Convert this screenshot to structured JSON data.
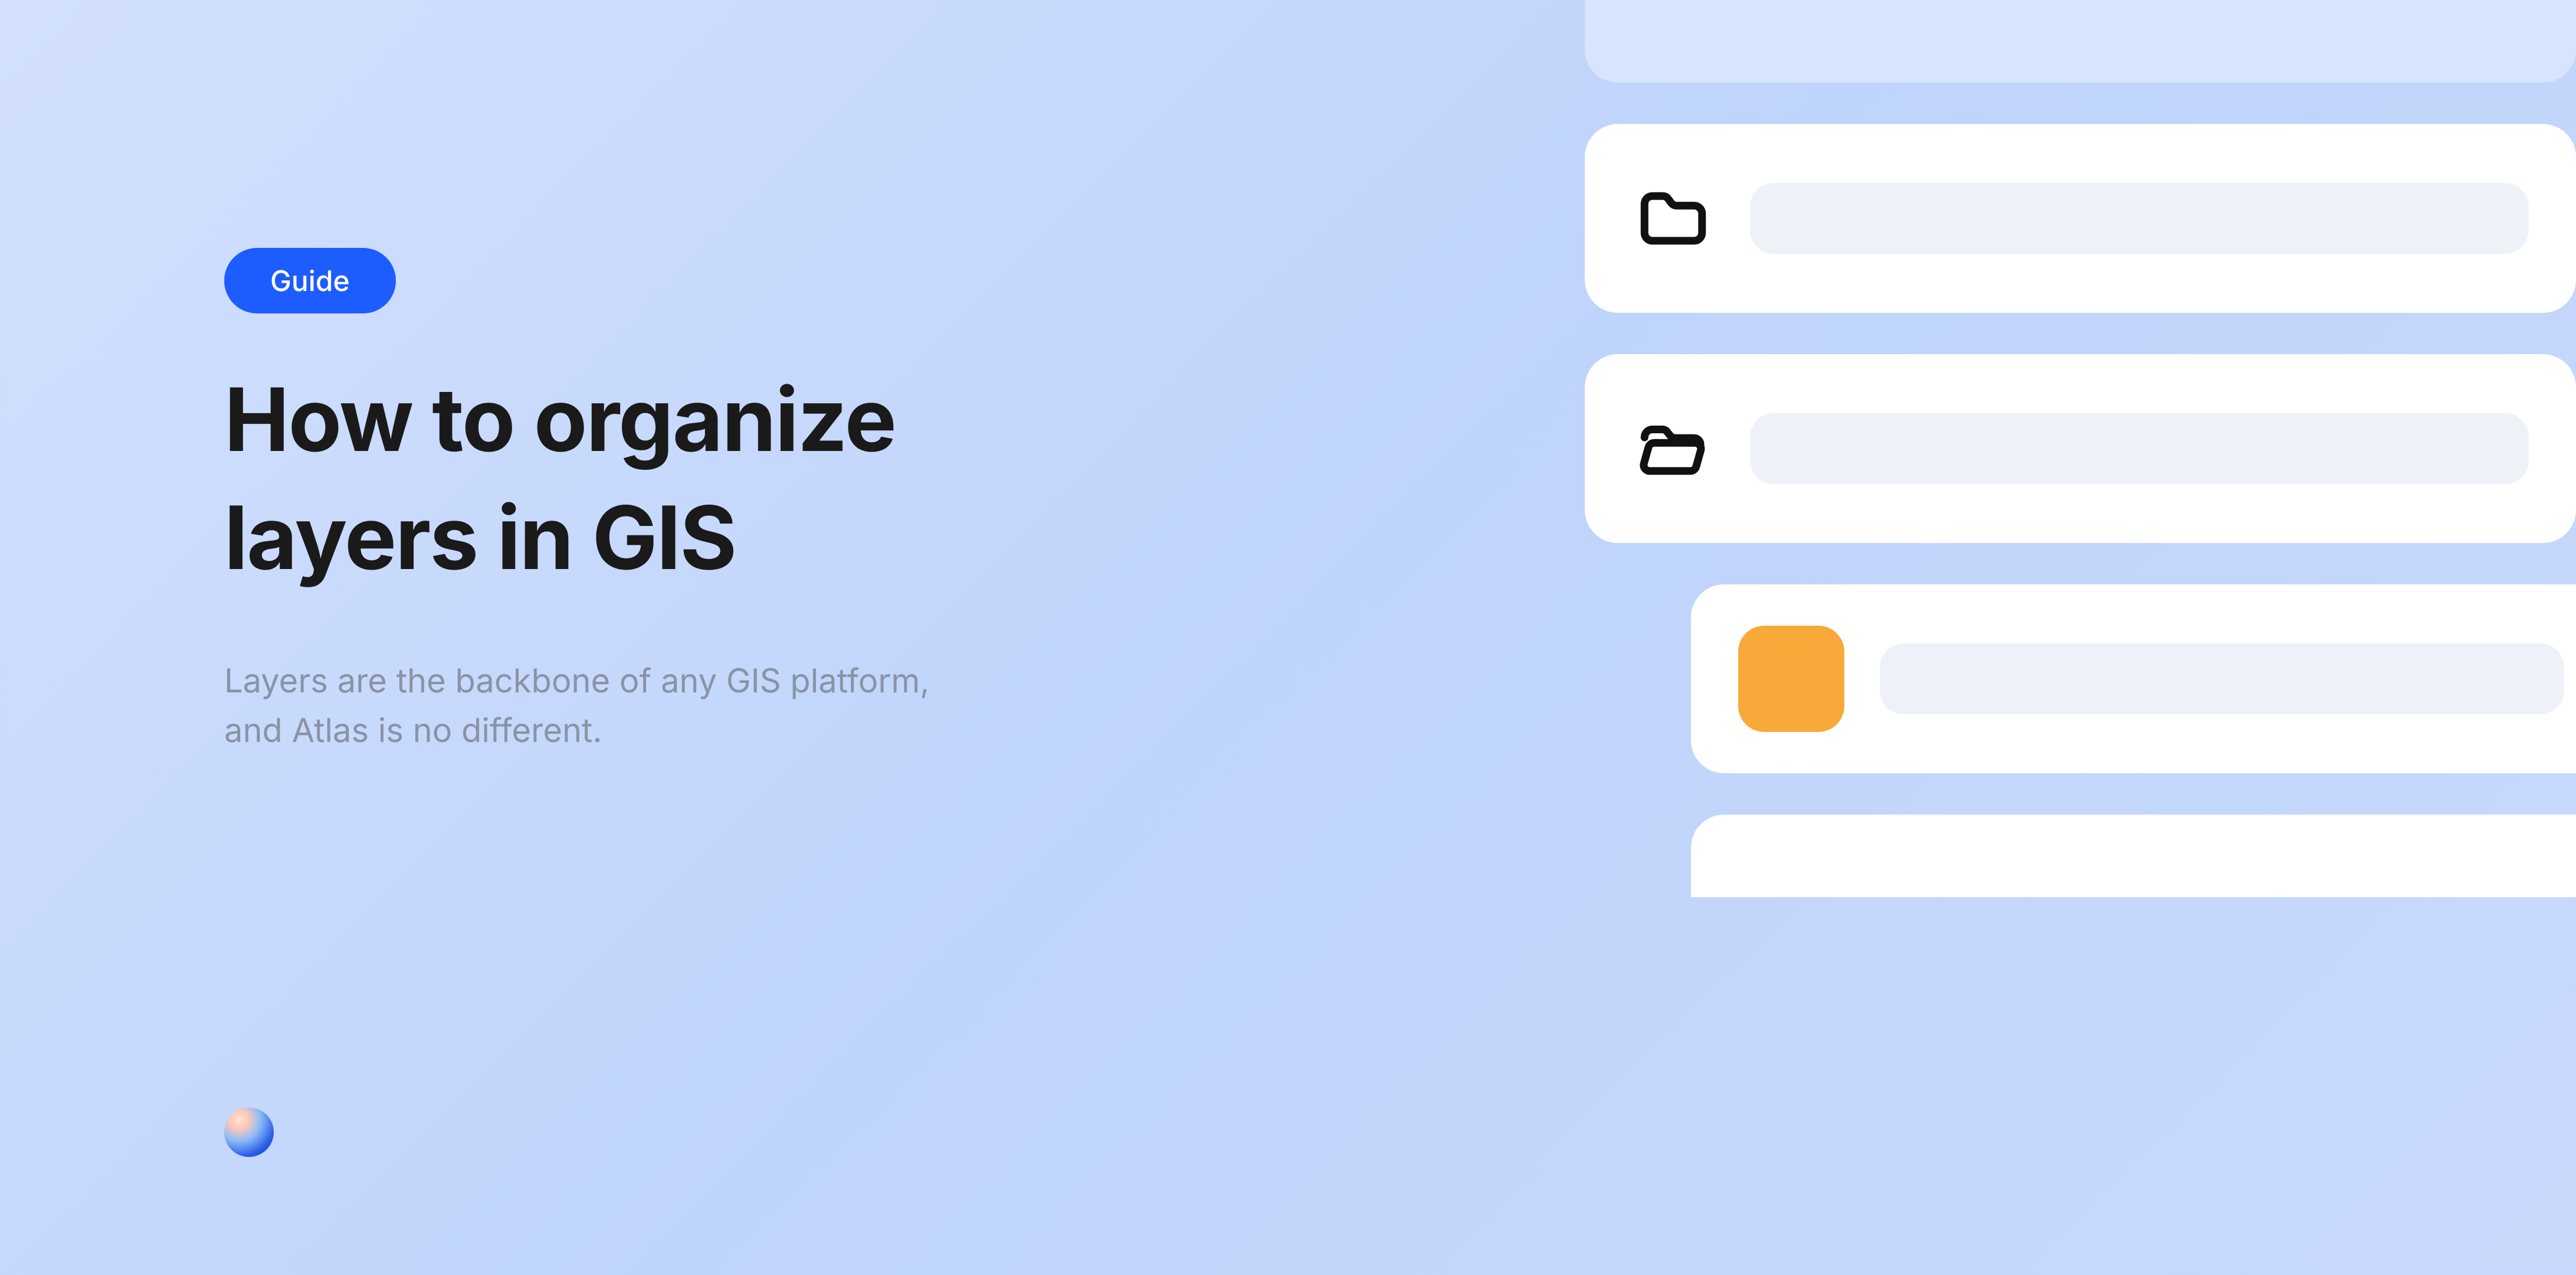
{
  "badge": "Guide",
  "title": "How to organize layers in GIS",
  "subtitle": "Layers are the backbone of any GIS platform, and Atlas is no different.",
  "cards": {
    "folder_closed_icon": "folder-icon",
    "folder_open_icon": "folder-open-icon",
    "chip_color": "#f8a93a"
  },
  "colors": {
    "accent": "#1d5dff",
    "bg_gradient_start": "#d2e0fd",
    "bg_gradient_end": "#c8d9fc"
  }
}
